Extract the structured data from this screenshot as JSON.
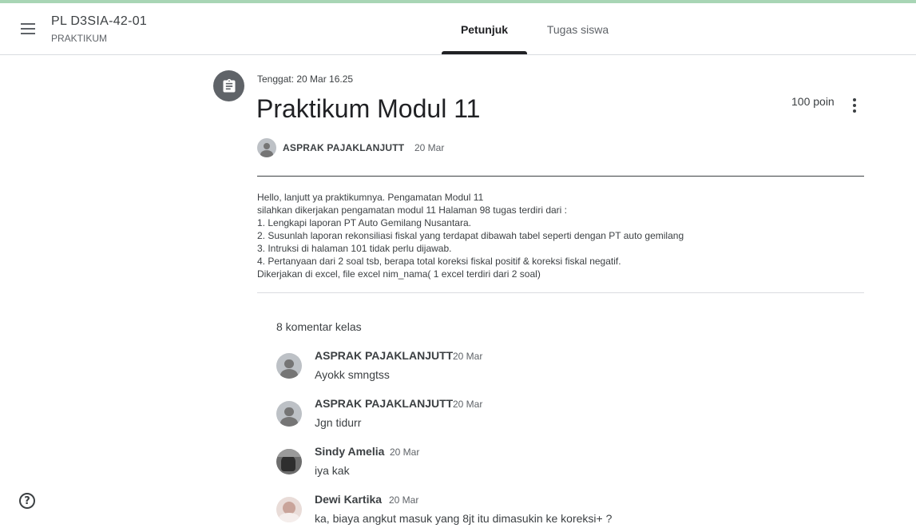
{
  "header": {
    "class_name": "PL D3SIA-42-01",
    "class_section": "PRAKTIKUM",
    "tabs": [
      {
        "label": "Petunjuk",
        "active": true
      },
      {
        "label": "Tugas siswa",
        "active": false
      }
    ]
  },
  "assignment": {
    "due": "Tenggat: 20 Mar 16.25",
    "title": "Praktikum Modul 11",
    "points": "100 poin",
    "author": "ASPRAK PAJAKLANJUTT",
    "date": "20 Mar",
    "instructions": [
      "Hello, lanjutt ya praktikumnya. Pengamatan Modul 11",
      "silahkan dikerjakan pengamatan modul 11 Halaman 98 tugas terdiri dari :",
      "1. Lengkapi laporan PT Auto Gemilang Nusantara.",
      "2. Susunlah laporan rekonsiliasi fiskal yang terdapat dibawah tabel seperti dengan PT auto gemilang",
      "3. Intruksi di halaman 101 tidak perlu dijawab.",
      "4. Pertanyaan dari 2 soal tsb, berapa total koreksi fiskal positif & koreksi fiskal negatif.",
      "Dikerjakan di excel, file excel nim_nama( 1 excel terdiri dari 2 soal)"
    ]
  },
  "comments": {
    "count_label": "8 komentar kelas",
    "items": [
      {
        "name": "ASPRAK PAJAKLANJUTT",
        "date": "20 Mar",
        "text": "Ayokk smngtss"
      },
      {
        "name": "ASPRAK PAJAKLANJUTT",
        "date": "20 Mar",
        "text": "Jgn tidurr"
      },
      {
        "name": "Sindy Amelia",
        "date": "20 Mar",
        "text": "iya kak"
      },
      {
        "name": "Dewi Kartika",
        "date": "20 Mar",
        "text": "ka, biaya angkut masuk yang 8jt itu dimasukin ke koreksi+ ?"
      }
    ]
  },
  "help": {
    "label": "?"
  },
  "colors": {
    "accent_bar": "#a8d5b5",
    "tab_indicator": "#202124",
    "icon_bg": "#5f6368"
  },
  "icons": [
    "menu-icon",
    "assignment-icon",
    "more-vert-icon",
    "help-icon"
  ]
}
